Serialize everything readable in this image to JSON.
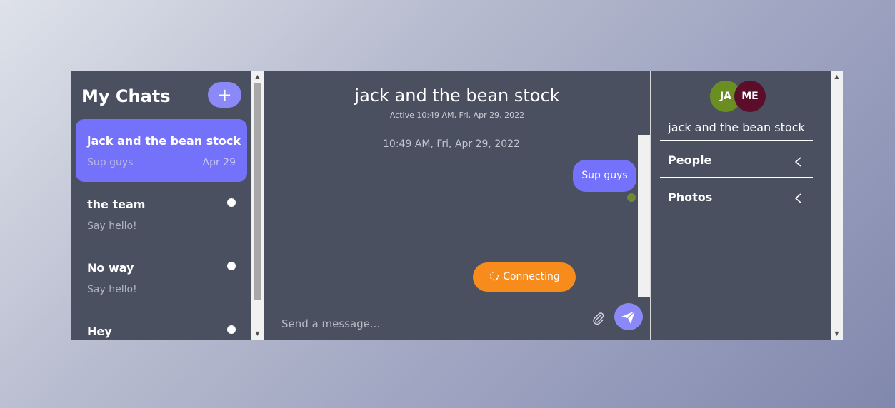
{
  "sidebar": {
    "title": "My Chats",
    "add_label": "+",
    "chats": [
      {
        "name": "jack and the bean stock",
        "last": "Sup guys",
        "date": "Apr 29"
      },
      {
        "name": "the team",
        "last": "Say hello!",
        "date": ""
      },
      {
        "name": "No way",
        "last": "Say hello!",
        "date": ""
      },
      {
        "name": "Hey",
        "last": "",
        "date": ""
      }
    ]
  },
  "conversation": {
    "title": "jack and the bean stock",
    "active": "Active 10:49 AM, Fri, Apr 29, 2022",
    "timestamp": "10:49 AM, Fri, Apr 29, 2022",
    "message": "Sup guys",
    "status": "Connecting",
    "input_placeholder": "Send a message..."
  },
  "details": {
    "avatars": [
      "JA",
      "ME"
    ],
    "title": "jack and the bean stock",
    "sections": [
      "People",
      "Photos"
    ]
  },
  "colors": {
    "panel": "#4b5061",
    "accent": "#7471fa",
    "button": "#8b88f8",
    "connecting": "#f78c1c",
    "avatar_ja": "#6b8e23",
    "avatar_me": "#5c0d2a"
  },
  "icons": [
    "plus-icon",
    "refresh-icon",
    "paperclip-icon",
    "send-icon",
    "chevron-left-icon"
  ]
}
